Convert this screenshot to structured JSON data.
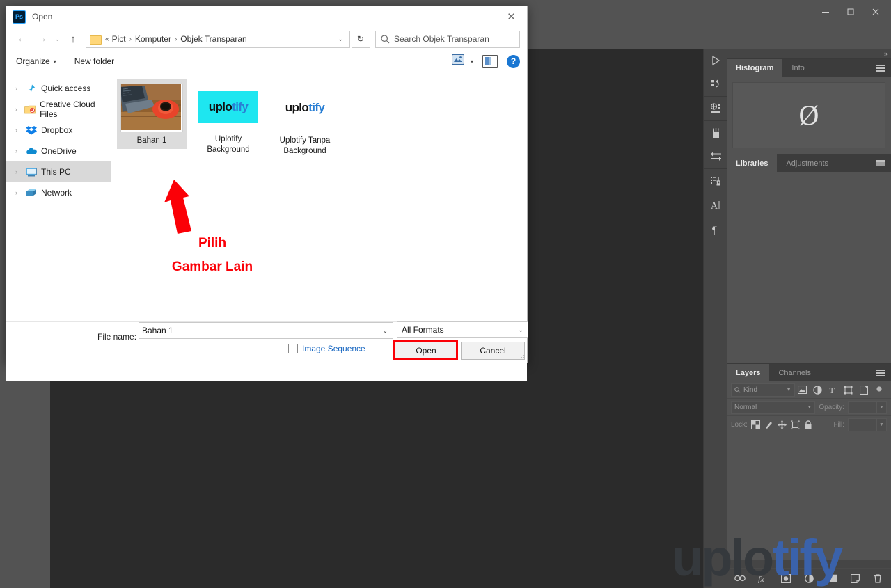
{
  "photoshop": {
    "window_controls": [
      "minimize",
      "maximize",
      "close"
    ],
    "option_bar_icons": [
      "search-icon",
      "workspace-icon",
      "chevron-down-icon"
    ],
    "rail_icons": [
      "play-icon",
      "timeline-icon",
      "3d-icon",
      "brush-icon",
      "styles-icon",
      "stamp-icon",
      "type-icon",
      "paragraph-icon"
    ],
    "dock": {
      "collapse_glyph": "»",
      "histogram_panel": {
        "tabs": [
          {
            "label": "Histogram",
            "active": true
          },
          {
            "label": "Info",
            "active": false
          }
        ],
        "empty_glyph": "Ø"
      },
      "libraries_panel": {
        "tabs": [
          {
            "label": "Libraries",
            "active": true
          },
          {
            "label": "Adjustments",
            "active": false
          }
        ]
      },
      "layers_panel": {
        "tabs": [
          {
            "label": "Layers",
            "active": true
          },
          {
            "label": "Channels",
            "active": false
          }
        ],
        "filter_placeholder": "Kind",
        "filter_icons": [
          "image-filter-icon",
          "adjustment-filter-icon",
          "type-filter-icon",
          "shape-filter-icon",
          "smartobject-filter-icon",
          "filter-toggle-icon"
        ],
        "blend_mode": "Normal",
        "opacity_label": "Opacity:",
        "lock_label": "Lock:",
        "lock_icons": [
          "lock-transparent-icon",
          "lock-image-icon",
          "lock-position-icon",
          "lock-artboard-icon",
          "lock-all-icon"
        ],
        "fill_label": "Fill:",
        "bottom_icons": [
          "link-layers-icon",
          "fx-icon",
          "layer-mask-icon",
          "adjustment-layer-icon",
          "new-group-icon",
          "new-layer-icon",
          "delete-layer-icon"
        ]
      }
    },
    "watermark": {
      "part1": "uplo",
      "part2": "tify",
      "color1": "#35393d",
      "color2": "#3a62ab"
    }
  },
  "dialog": {
    "title": "Open",
    "app_badge": "Ps",
    "close_glyph": "✕",
    "nav": {
      "back_glyph": "←",
      "forward_glyph": "→",
      "recent_glyph": "⌄",
      "up_glyph": "↑",
      "breadcrumb_prefix": "«",
      "breadcrumbs": [
        "Pict",
        "Komputer",
        "Objek Transparan"
      ],
      "separator": "›",
      "dropdown_glyph": "⌄",
      "refresh_glyph": "↻"
    },
    "search": {
      "placeholder": "Search Objek Transparan",
      "icon": "search-icon"
    },
    "toolbar": {
      "organize_label": "Organize",
      "new_folder_label": "New folder",
      "caret_glyph": "▾",
      "view_icon": "view-layout-icon",
      "pane_icon": "preview-pane-icon",
      "help_icon": "help-icon",
      "help_glyph": "?"
    },
    "sidebar": {
      "items": [
        {
          "label": "Quick access",
          "icon": "pin-icon",
          "selected": false
        },
        {
          "label": "Creative Cloud Files",
          "icon": "creative-cloud-icon",
          "selected": false
        },
        {
          "label": "Dropbox",
          "icon": "dropbox-icon",
          "selected": false
        },
        {
          "label": "OneDrive",
          "icon": "onedrive-icon",
          "selected": false
        },
        {
          "label": "This PC",
          "icon": "this-pc-icon",
          "selected": true
        },
        {
          "label": "Network",
          "icon": "network-icon",
          "selected": false
        }
      ],
      "expander_glyph": "›"
    },
    "files": [
      {
        "name": "Bahan 1",
        "type": "photo",
        "selected": true
      },
      {
        "name": "Uplotify Background",
        "type": "logo-cyan",
        "selected": false
      },
      {
        "name": "Uplotify Tanpa Background",
        "type": "logo-white",
        "selected": false
      }
    ],
    "logo_text": {
      "part1": "uplo",
      "part2": "tify"
    },
    "footer": {
      "file_name_label": "File name:",
      "file_name_label_accel": "n",
      "file_name_value": "Bahan 1",
      "format_value": "All Formats",
      "image_sequence_label": "Image Sequence",
      "image_sequence_checked": false,
      "open_label": "Open",
      "open_label_accel": "O",
      "cancel_label": "Cancel",
      "dropdown_glyph": "⌄"
    }
  },
  "annotation": {
    "line1": "Pilih",
    "line2": "Gambar Lain",
    "color": "#fb0007",
    "arrow": "up-arrow-annotation"
  }
}
